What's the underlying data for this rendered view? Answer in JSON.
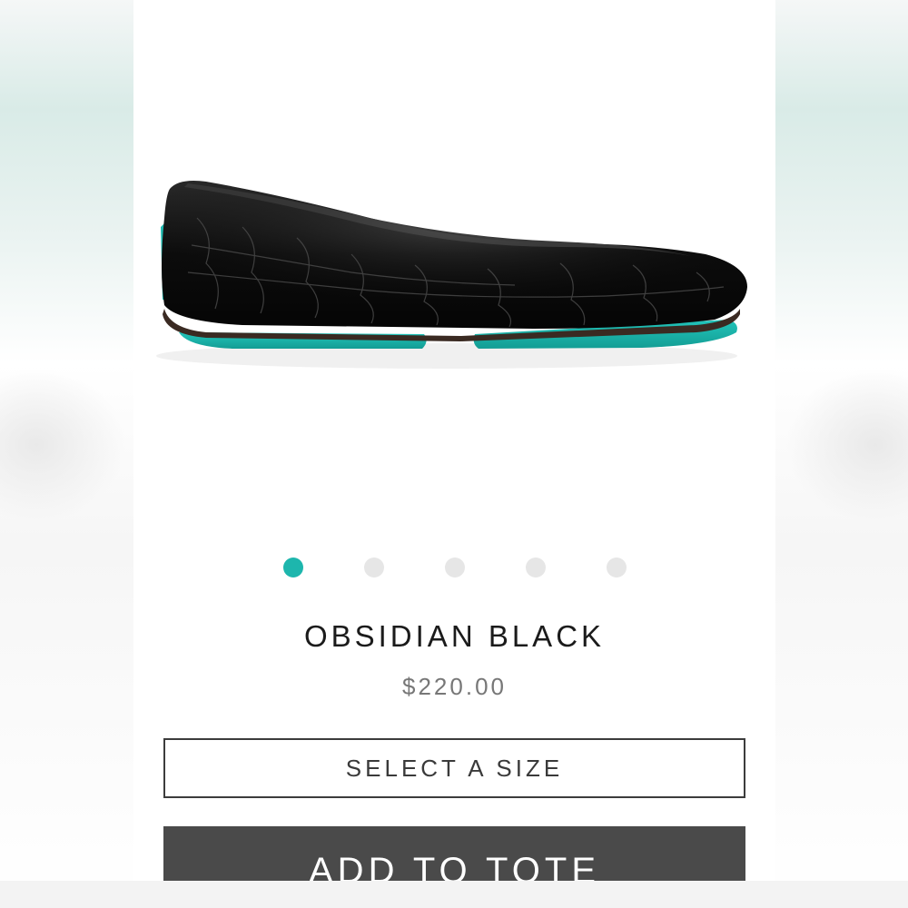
{
  "product": {
    "name": "OBSIDIAN BLACK",
    "price": "$220.00",
    "image_icon": "ballet-flat-shoe-image",
    "gallery": {
      "count": 5,
      "active_index": 0,
      "active_color": "#1db6ad",
      "inactive_color": "#e6e6e6"
    }
  },
  "actions": {
    "select_size_label": "SELECT A SIZE",
    "add_to_tote_label": "ADD TO TOTE"
  },
  "colors": {
    "sole_accent": "#1db6ad",
    "button_bg": "#4a4a4a"
  }
}
